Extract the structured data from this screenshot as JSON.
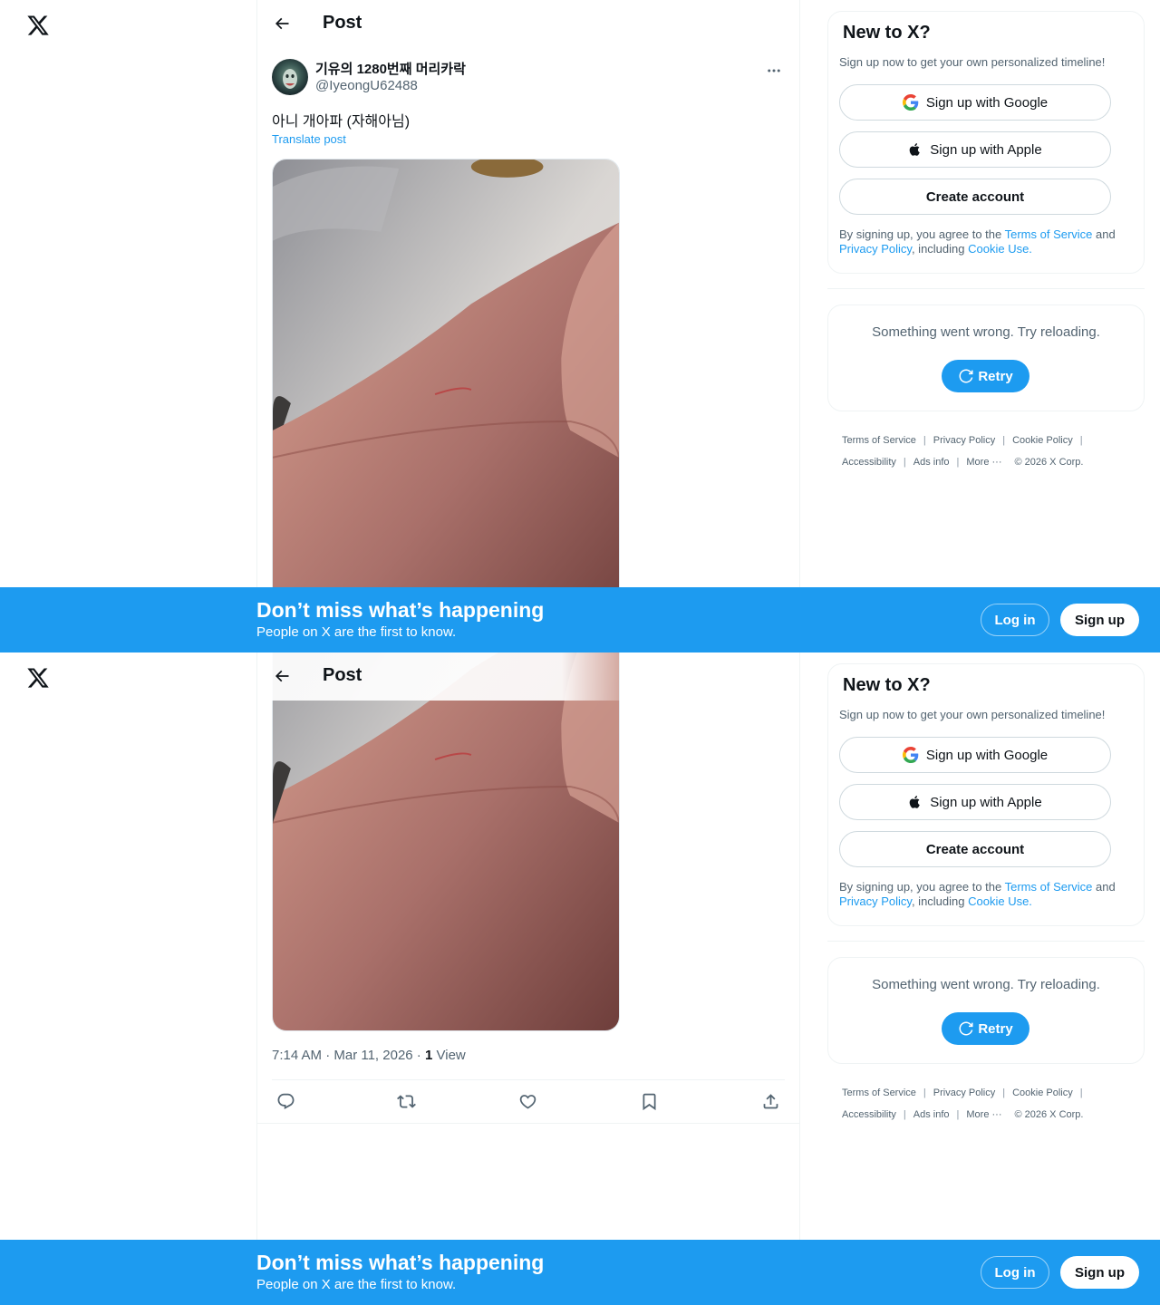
{
  "header": {
    "title": "Post"
  },
  "post": {
    "author_name": "기유의 1280번째 머리카락",
    "author_handle": "@IyeongU62488",
    "text": "아니 개아파 (자해아님)",
    "translate_label": "Translate post",
    "timestamp": "7:14 AM · Mar 11, 2026",
    "separator": " · ",
    "view_count": "1",
    "view_label": "View"
  },
  "signup_card": {
    "title": "New to X?",
    "subtitle": "Sign up now to get your own personalized timeline!",
    "google_label": "Sign up with Google",
    "apple_label": "Sign up with Apple",
    "create_label": "Create account",
    "legal_prefix": "By signing up, you agree to the ",
    "terms_link": "Terms of Service",
    "legal_and": " and",
    "privacy_link": "Privacy Policy",
    "legal_including": ", including ",
    "cookie_link": "Cookie Use."
  },
  "error_card": {
    "message": "Something went wrong. Try reloading.",
    "retry_label": "Retry"
  },
  "footer": {
    "terms": "Terms of Service",
    "privacy": "Privacy Policy",
    "cookie": "Cookie Policy",
    "accessibility": "Accessibility",
    "ads": "Ads info",
    "more": "More ···",
    "copyright": "© 2026 X Corp.",
    "sep": "|"
  },
  "banner": {
    "title": "Don’t miss what’s happening",
    "subtitle": "People on X are the first to know.",
    "login_label": "Log in",
    "signup_label": "Sign up"
  },
  "colors": {
    "accent": "#1d9bf0",
    "text_primary": "#0f1419",
    "text_secondary": "#536471",
    "border": "#eff3f4"
  }
}
